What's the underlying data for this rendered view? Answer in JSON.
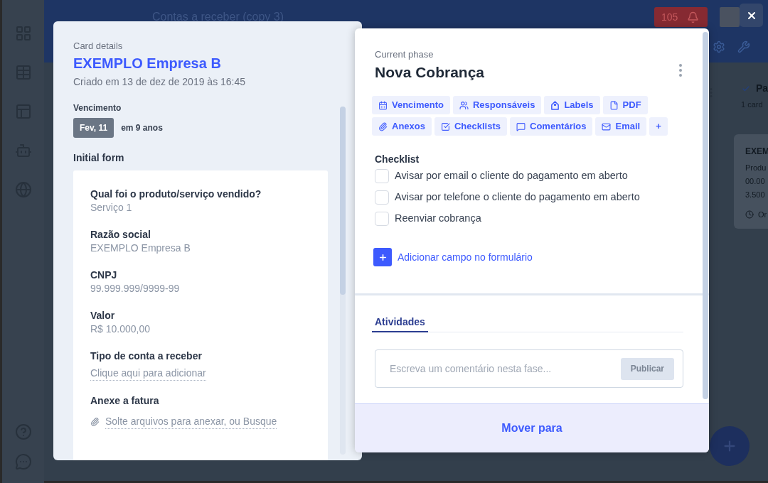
{
  "app": {
    "title": "Contas a receber (copy 3)",
    "notifications": "105"
  },
  "board": {
    "column": {
      "title": "Pa",
      "count": "1 card",
      "card": {
        "title": "EXEM",
        "lines": [
          "Produ",
          "00.00",
          "3.500"
        ],
        "footer_text": "Or"
      }
    }
  },
  "card_details": {
    "heading": "Card details",
    "title": "EXEMPLO Empresa B",
    "created": "Criado em 13 de dez de 2019 às 16:45",
    "due": {
      "label": "Vencimento",
      "date": "Fev, 11",
      "relative": "em 9 anos"
    },
    "form": {
      "title": "Initial form",
      "fields": [
        {
          "kind": "text",
          "label": "Qual foi o produto/serviço vendido?",
          "value": "Serviço 1"
        },
        {
          "kind": "text",
          "label": "Razão social",
          "value": "EXEMPLO Empresa B"
        },
        {
          "kind": "text",
          "label": "CNPJ",
          "value": "99.999.999/9999-99"
        },
        {
          "kind": "text",
          "label": "Valor",
          "value": "R$ 10.000,00"
        },
        {
          "kind": "link",
          "label": "Tipo de conta a receber",
          "value": "Clique aqui para adicionar"
        },
        {
          "kind": "file",
          "label": "Anexe a fatura",
          "value": "Solte arquivos para anexar, ou Busque"
        }
      ]
    }
  },
  "phase": {
    "heading": "Current phase",
    "title": "Nova Cobrança",
    "actions": [
      {
        "kind": "date",
        "label": "Vencimento"
      },
      {
        "kind": "people",
        "label": "Responsáveis"
      },
      {
        "kind": "label",
        "label": "Labels"
      },
      {
        "kind": "pdf",
        "label": "PDF"
      },
      {
        "kind": "attachment",
        "label": "Anexos"
      },
      {
        "kind": "checklist",
        "label": "Checklists"
      },
      {
        "kind": "comment",
        "label": "Comentários"
      },
      {
        "kind": "email",
        "label": "Email"
      },
      {
        "kind": "add",
        "label": "+"
      }
    ],
    "checklist": {
      "title": "Checklist",
      "items": [
        {
          "label": "Avisar por email o cliente do pagamento em aberto",
          "checked": false
        },
        {
          "label": "Avisar por telefone o cliente do pagamento em aberto",
          "checked": false
        },
        {
          "label": "Reenviar cobrança",
          "checked": false
        }
      ]
    },
    "add_field": {
      "label": "Adicionar campo no formulário"
    }
  },
  "activity": {
    "tabs": [
      {
        "label": "Atividades",
        "selected": true
      }
    ],
    "comment": {
      "placeholder": "Escreva um comentário nesta fase...",
      "button": "Publicar"
    }
  },
  "footer": {
    "button": "Mover para"
  }
}
